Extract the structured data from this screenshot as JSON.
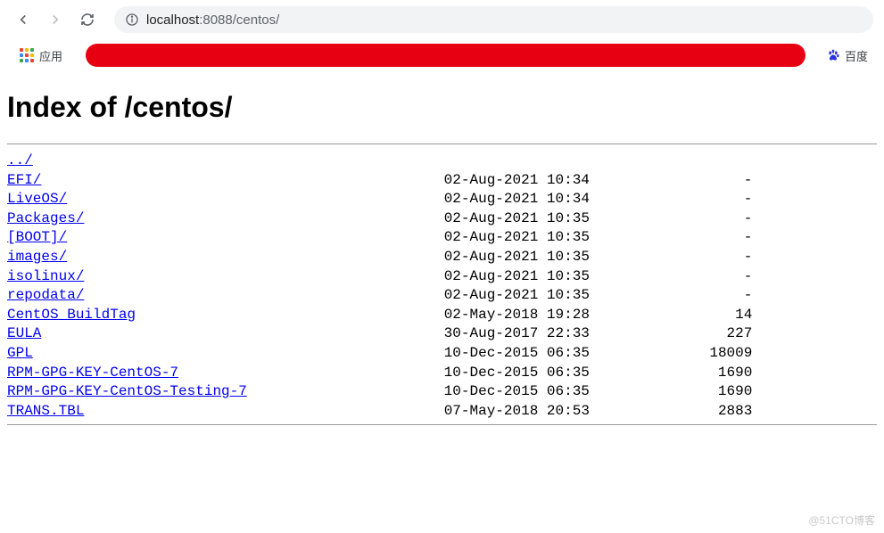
{
  "toolbar": {
    "url_prefix": "localhost",
    "url_port": ":8088",
    "url_path": "/centos/"
  },
  "bookmarks": {
    "apps_label": "应用",
    "baidu_label": "百度"
  },
  "page": {
    "title": "Index of /centos/",
    "parent_link": "../"
  },
  "listing": [
    {
      "name": "EFI/",
      "date": "02-Aug-2021 10:34",
      "size": "-"
    },
    {
      "name": "LiveOS/",
      "date": "02-Aug-2021 10:34",
      "size": "-"
    },
    {
      "name": "Packages/",
      "date": "02-Aug-2021 10:35",
      "size": "-"
    },
    {
      "name": "[BOOT]/",
      "date": "02-Aug-2021 10:35",
      "size": "-"
    },
    {
      "name": "images/",
      "date": "02-Aug-2021 10:35",
      "size": "-"
    },
    {
      "name": "isolinux/",
      "date": "02-Aug-2021 10:35",
      "size": "-"
    },
    {
      "name": "repodata/",
      "date": "02-Aug-2021 10:35",
      "size": "-"
    },
    {
      "name": "CentOS_BuildTag",
      "date": "02-May-2018 19:28",
      "size": "14"
    },
    {
      "name": "EULA",
      "date": "30-Aug-2017 22:33",
      "size": "227"
    },
    {
      "name": "GPL",
      "date": "10-Dec-2015 06:35",
      "size": "18009"
    },
    {
      "name": "RPM-GPG-KEY-CentOS-7",
      "date": "10-Dec-2015 06:35",
      "size": "1690"
    },
    {
      "name": "RPM-GPG-KEY-CentOS-Testing-7",
      "date": "10-Dec-2015 06:35",
      "size": "1690"
    },
    {
      "name": "TRANS.TBL",
      "date": "07-May-2018 20:53",
      "size": "2883"
    }
  ],
  "watermark": "@51CTO博客"
}
